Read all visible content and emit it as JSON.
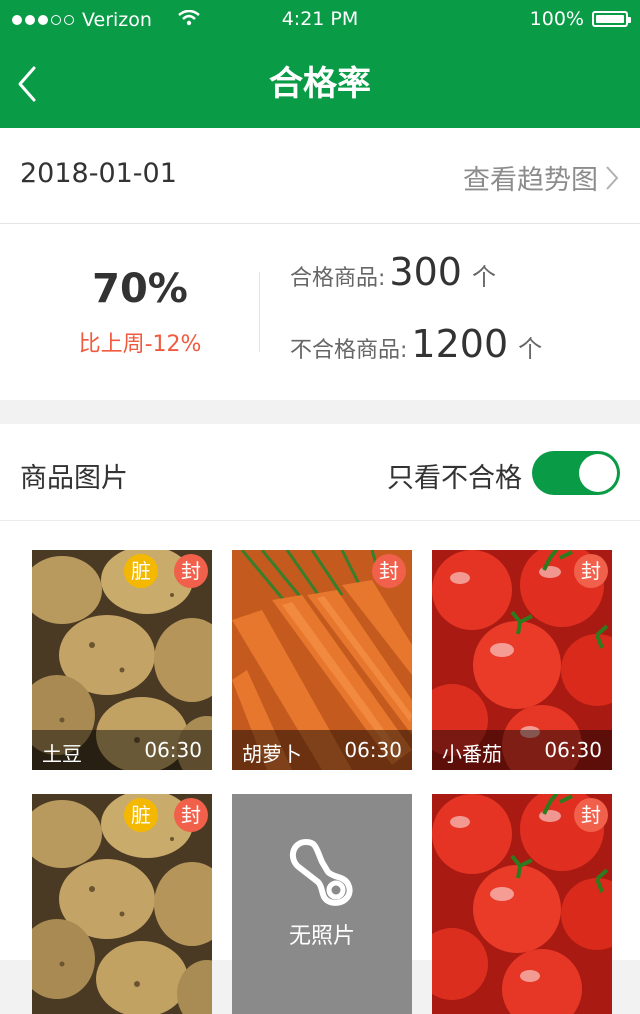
{
  "status_bar": {
    "carrier": "Verizon",
    "time": "4:21 PM",
    "battery": "100%"
  },
  "nav": {
    "title": "合格率"
  },
  "date_row": {
    "date": "2018-01-01",
    "trend_link": "查看趋势图"
  },
  "stats": {
    "pass_rate": "70%",
    "change": "比上周-12%",
    "qualified_label": "合格商品:",
    "qualified_count": "300",
    "unqualified_label": "不合格商品:",
    "unqualified_count": "1200",
    "unit": "个"
  },
  "photos": {
    "title": "商品图片",
    "filter_label": "只看不合格",
    "filter_on": true,
    "cards": [
      {
        "name": "土豆",
        "time": "06:30",
        "badges": [
          "脏",
          "封"
        ]
      },
      {
        "name": "胡萝卜",
        "time": "06:30",
        "badges": [
          "封"
        ]
      },
      {
        "name": "小番茄",
        "time": "06:30",
        "badges": [
          "封"
        ]
      },
      {
        "name": "",
        "time": "",
        "badges": [
          "脏",
          "封"
        ]
      },
      {
        "name": "",
        "time": "",
        "badges": [],
        "no_photo_label": "无照片"
      },
      {
        "name": "",
        "time": "",
        "badges": [
          "封"
        ]
      }
    ]
  },
  "colors": {
    "brand": "#0a9b47",
    "negative": "#f05a3e",
    "dirty_badge": "#f5b800",
    "seal_badge": "#f0604a"
  }
}
